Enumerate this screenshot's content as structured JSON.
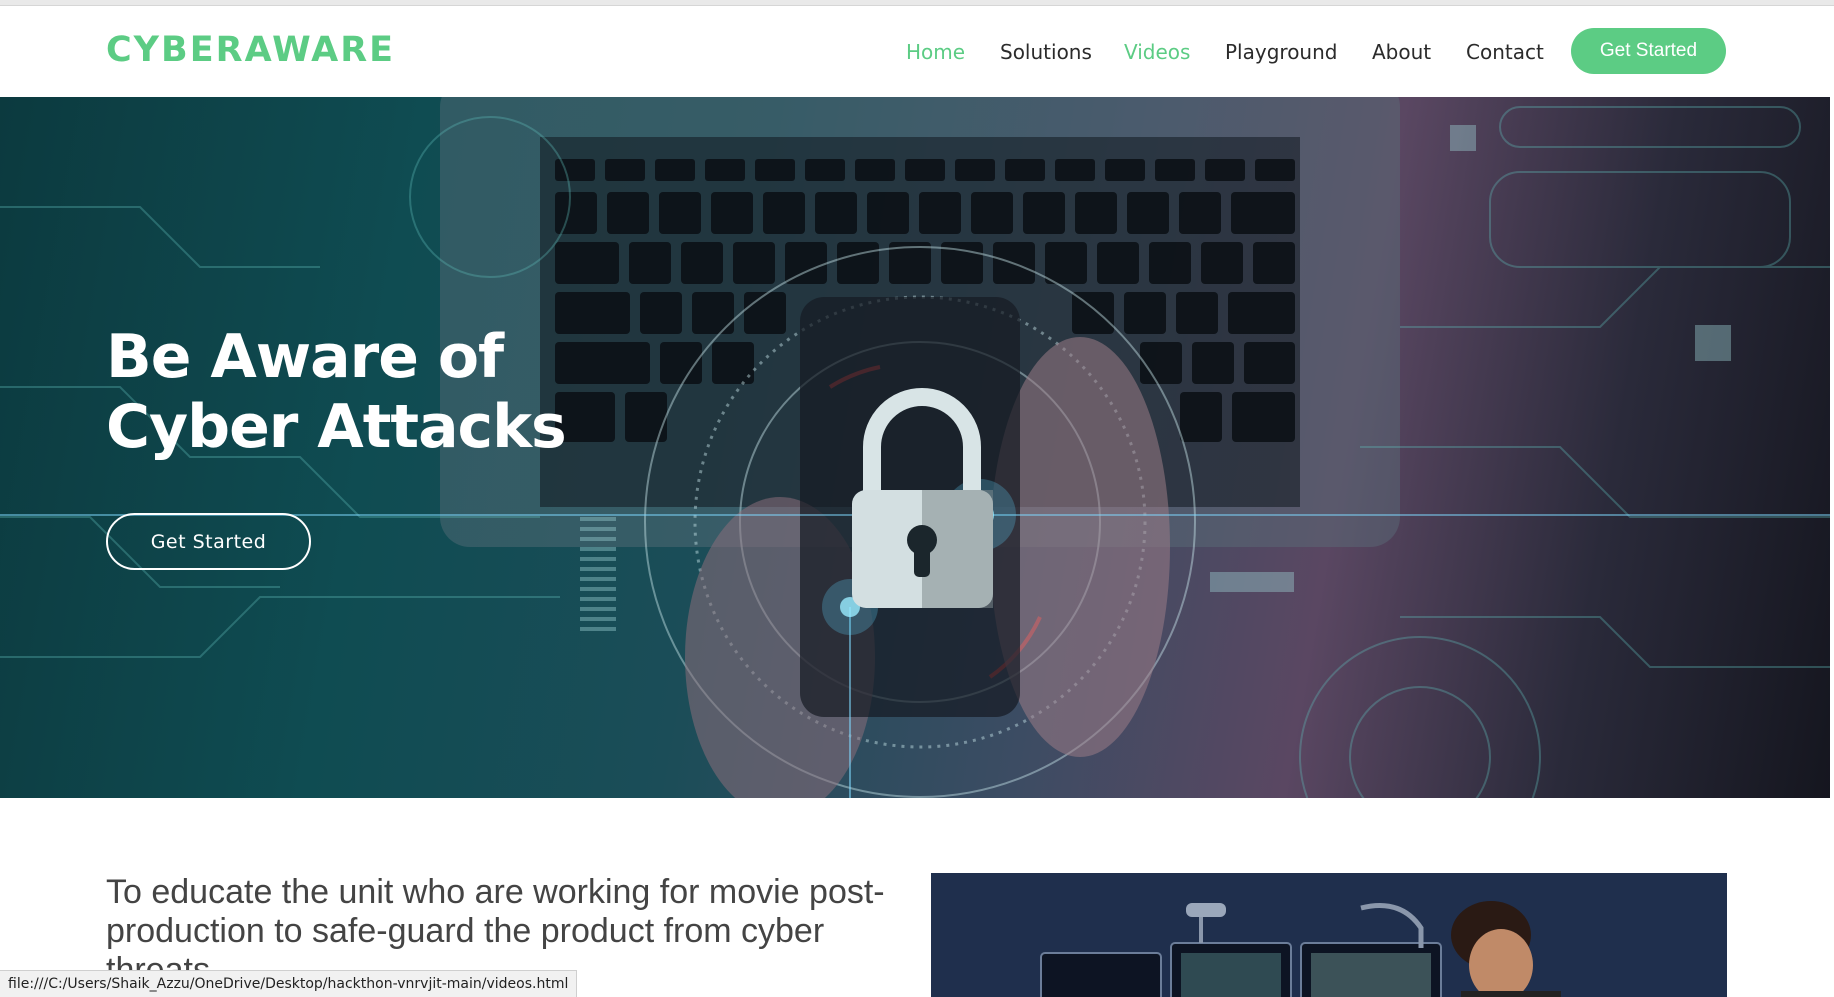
{
  "header": {
    "logo": "CYBERAWARE",
    "nav": [
      {
        "label": "Home",
        "active": true
      },
      {
        "label": "Solutions",
        "active": false
      },
      {
        "label": "Videos",
        "active": true
      },
      {
        "label": "Playground",
        "active": false
      },
      {
        "label": "About",
        "active": false
      },
      {
        "label": "Contact",
        "active": false
      }
    ],
    "cta_label": "Get Started"
  },
  "hero": {
    "title_line1": "Be Aware of",
    "title_line2": "Cyber Attacks",
    "button_label": "Get Started"
  },
  "about": {
    "text": "To educate the unit who are working for movie post-production to safe-guard the product from cyber threats"
  },
  "statusbar": {
    "url": "file:///C:/Users/Shaik_Azzu/OneDrive/Desktop/hackthon-vnrvjit-main/videos.html"
  },
  "colors": {
    "accent": "#5ccc84",
    "text_dark": "#2b2b2b",
    "hero_bg": "#0f4c52"
  },
  "icons": [
    "lock-icon"
  ]
}
